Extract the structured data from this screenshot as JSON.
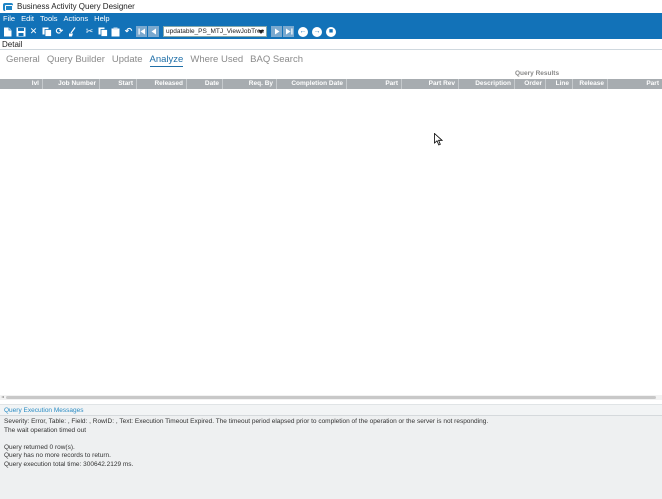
{
  "window": {
    "title": "Business Activity Query Designer"
  },
  "menu": {
    "items": [
      "File",
      "Edit",
      "Tools",
      "Actions",
      "Help"
    ]
  },
  "toolbar": {
    "query_combo": "updatable_PS_MTJ_ViewJobTree"
  },
  "detail_label": "Detail",
  "tabs": [
    "General",
    "Query Builder",
    "Update",
    "Analyze",
    "Where Used",
    "BAQ Search"
  ],
  "active_tab": "Analyze",
  "results": {
    "title": "Query Results",
    "columns": [
      "lvl",
      "Job Number",
      "Start",
      "Released",
      "Date",
      "Req. By",
      "Completion Date",
      "Part",
      "Part Rev",
      "Description",
      "Order",
      "Line",
      "Release",
      "Part"
    ]
  },
  "messages": {
    "header": "Query Execution Messages",
    "line1": "Severity: Error, Table: , Field: , RowID: , Text: Execution Timeout Expired.  The timeout period elapsed prior to completion of the operation or the server is not responding.",
    "line2": "The wait operation timed out",
    "line3": "Query returned 0 row(s).",
    "line4": "Query has no more records to return.",
    "line5": "Query execution total time: 300642.2129 ms."
  }
}
